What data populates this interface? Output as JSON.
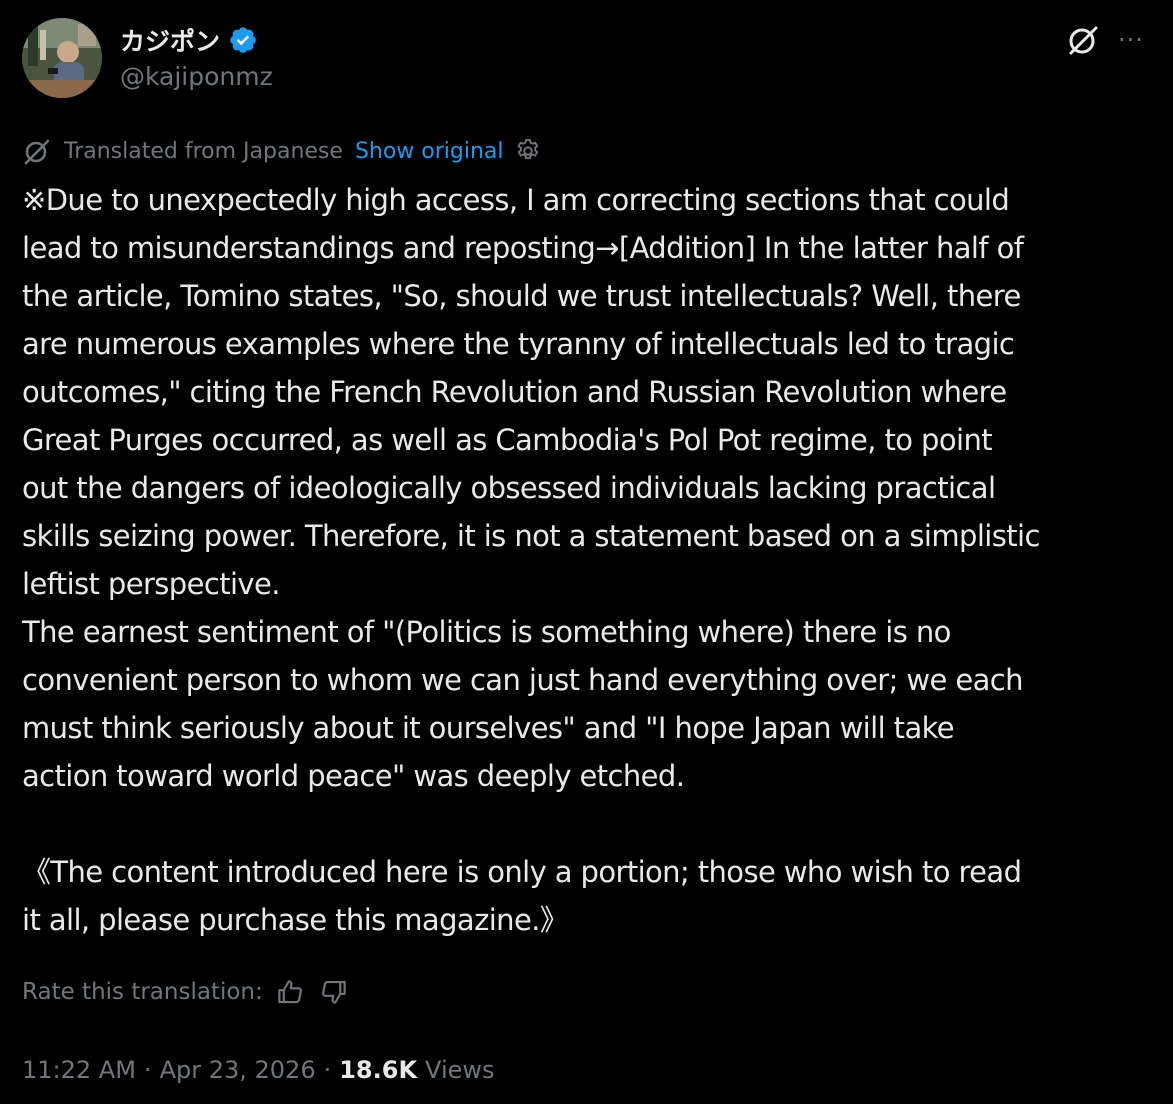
{
  "author": {
    "display_name": "カジポン",
    "handle": "@kajiponmz",
    "verified": true,
    "verified_color": "#1d9bf0"
  },
  "header": {
    "grok_icon": "grok-icon",
    "more_icon": "more-icon",
    "more_label": "···"
  },
  "translation": {
    "label": "Translated from Japanese",
    "show_original": "Show original",
    "settings_icon": "settings-gear-icon"
  },
  "body": {
    "lines": [
      "※Due to unexpectedly high access, I am correcting sections that could",
      "lead to misunderstandings and reposting→[Addition] In the latter half of",
      "the article, Tomino states, \"So, should we trust intellectuals? Well, there",
      "are numerous examples where the tyranny of intellectuals led to tragic",
      "outcomes,\" citing the French Revolution and Russian Revolution where",
      "Great Purges occurred, as well as Cambodia's Pol Pot regime, to point",
      "out the dangers of ideologically obsessed individuals lacking practical",
      "skills seizing power. Therefore, it is not a statement based on a simplistic",
      "leftist perspective.",
      "The earnest sentiment of \"(Politics is something where) there is no",
      "convenient person to whom we can just hand everything over; we each",
      "must think seriously about it ourselves\" and \"I hope Japan will take",
      "action toward world peace\" was deeply etched.",
      "",
      "《The content introduced here is only a portion; those who wish to read",
      "it all, please purchase this magazine.》"
    ]
  },
  "rate": {
    "label": "Rate this translation:",
    "thumbs_up_icon": "thumbs-up-icon",
    "thumbs_down_icon": "thumbs-down-icon"
  },
  "meta": {
    "time": "11:22 AM",
    "separator": "·",
    "date": "Apr 23, 2026",
    "views_count": "18.6K",
    "views_label": "Views"
  },
  "colors": {
    "background": "#000000",
    "text": "#e7e9ea",
    "muted": "#71767b",
    "accent": "#1d9bf0"
  }
}
